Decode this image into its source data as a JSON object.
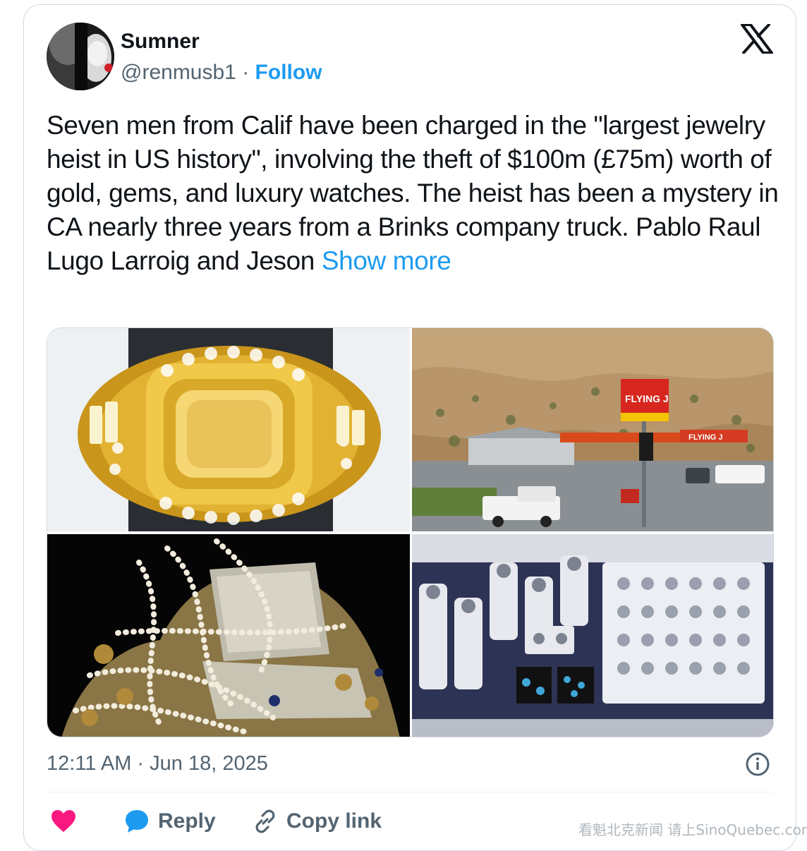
{
  "author": {
    "name": "Sumner",
    "handle": "@renmusb1",
    "separator": "·",
    "follow_label": "Follow"
  },
  "tweet": {
    "text": "Seven men from Calif have been charged in the \"largest jewelry heist in US history\", involving the theft of $100m (£75m) worth of gold, gems, and luxury watches. The heist has been a mystery in CA nearly three years from a Brinks company truck. Pablo Raul Lugo Larroig and Jeson",
    "show_more_label": "Show more"
  },
  "media": {
    "images": [
      {
        "subject": "gold-yellow-diamond-ring"
      },
      {
        "subject": "flying-j-gas-station-hills",
        "sign_text": "FLYING J"
      },
      {
        "subject": "pearls-and-gold-jewelry-pile"
      },
      {
        "subject": "jewelry-display-case-rings"
      }
    ]
  },
  "meta": {
    "timestamp": "12:11 AM · Jun 18, 2025"
  },
  "actions": {
    "like_count": "",
    "reply_label": "Reply",
    "copy_link_label": "Copy link"
  },
  "watermark": "看魁北克新闻 请上SinoQuebec.com",
  "colors": {
    "accent": "#1d9bf0",
    "text_primary": "#0f1419",
    "text_secondary": "#536471",
    "like": "#f91880",
    "border": "#cfd9de"
  },
  "icons": [
    "x-logo-icon",
    "info-icon",
    "heart-icon",
    "reply-bubble-icon",
    "link-icon"
  ]
}
